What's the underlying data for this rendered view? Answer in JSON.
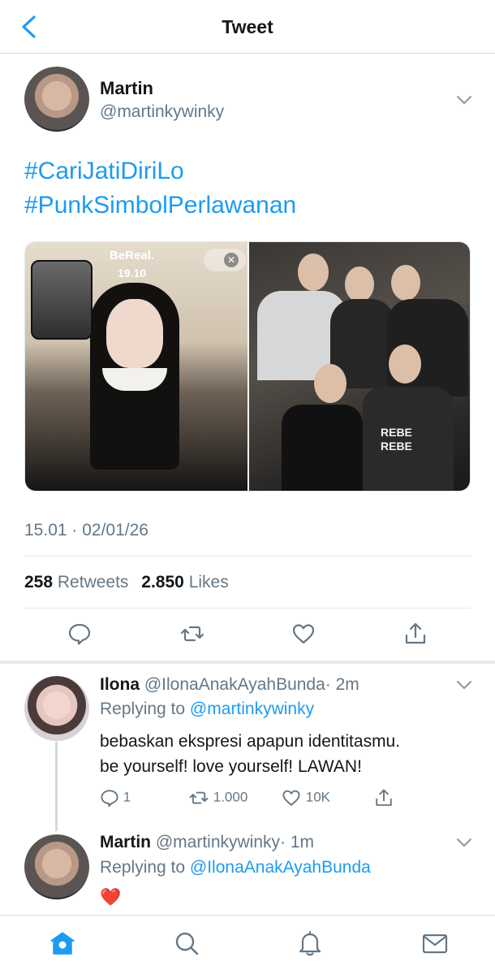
{
  "header": {
    "title": "Tweet"
  },
  "tweet": {
    "author_name": "Martin",
    "author_handle": "@martinkywinky",
    "hashtags": [
      "#CariJatiDiriLo",
      "#PunkSimbolPerlawanan"
    ],
    "media": {
      "bereal_logo": "BeReal.",
      "bereal_time": "19.10",
      "shirt_text": [
        "REBE",
        "REBE"
      ]
    },
    "timestamp": "15.01 · 02/01/26",
    "retweets_count": "258",
    "retweets_label": "Retweets",
    "likes_count": "2.850",
    "likes_label": "Likes",
    "actions": [
      "reply-icon",
      "retweet-icon",
      "like-icon",
      "share-icon"
    ]
  },
  "replies": [
    {
      "name": "Ilona",
      "handle": "@IlonaAnakAyahBunda",
      "time": "· 2m",
      "replying_prefix": "Replying to",
      "replying_to": "@martinkywinky",
      "text_lines": [
        "bebaskan ekspresi apapun identitasmu.",
        "be yourself! love yourself! LAWAN!"
      ],
      "reply_count": "1",
      "retweet_count": "1.000",
      "like_count": "10K"
    },
    {
      "name": "Martin",
      "handle": "@martinkywinky",
      "time": "· 1m",
      "replying_prefix": "Replying to",
      "replying_to": "@IlonaAnakAyahBunda",
      "text": "❤️"
    }
  ],
  "tabbar": [
    "home-icon",
    "search-icon",
    "notifications-icon",
    "messages-icon"
  ],
  "colors": {
    "accent": "#1d9bf0",
    "secondary_text": "#657786",
    "heart": "#e0245e"
  }
}
